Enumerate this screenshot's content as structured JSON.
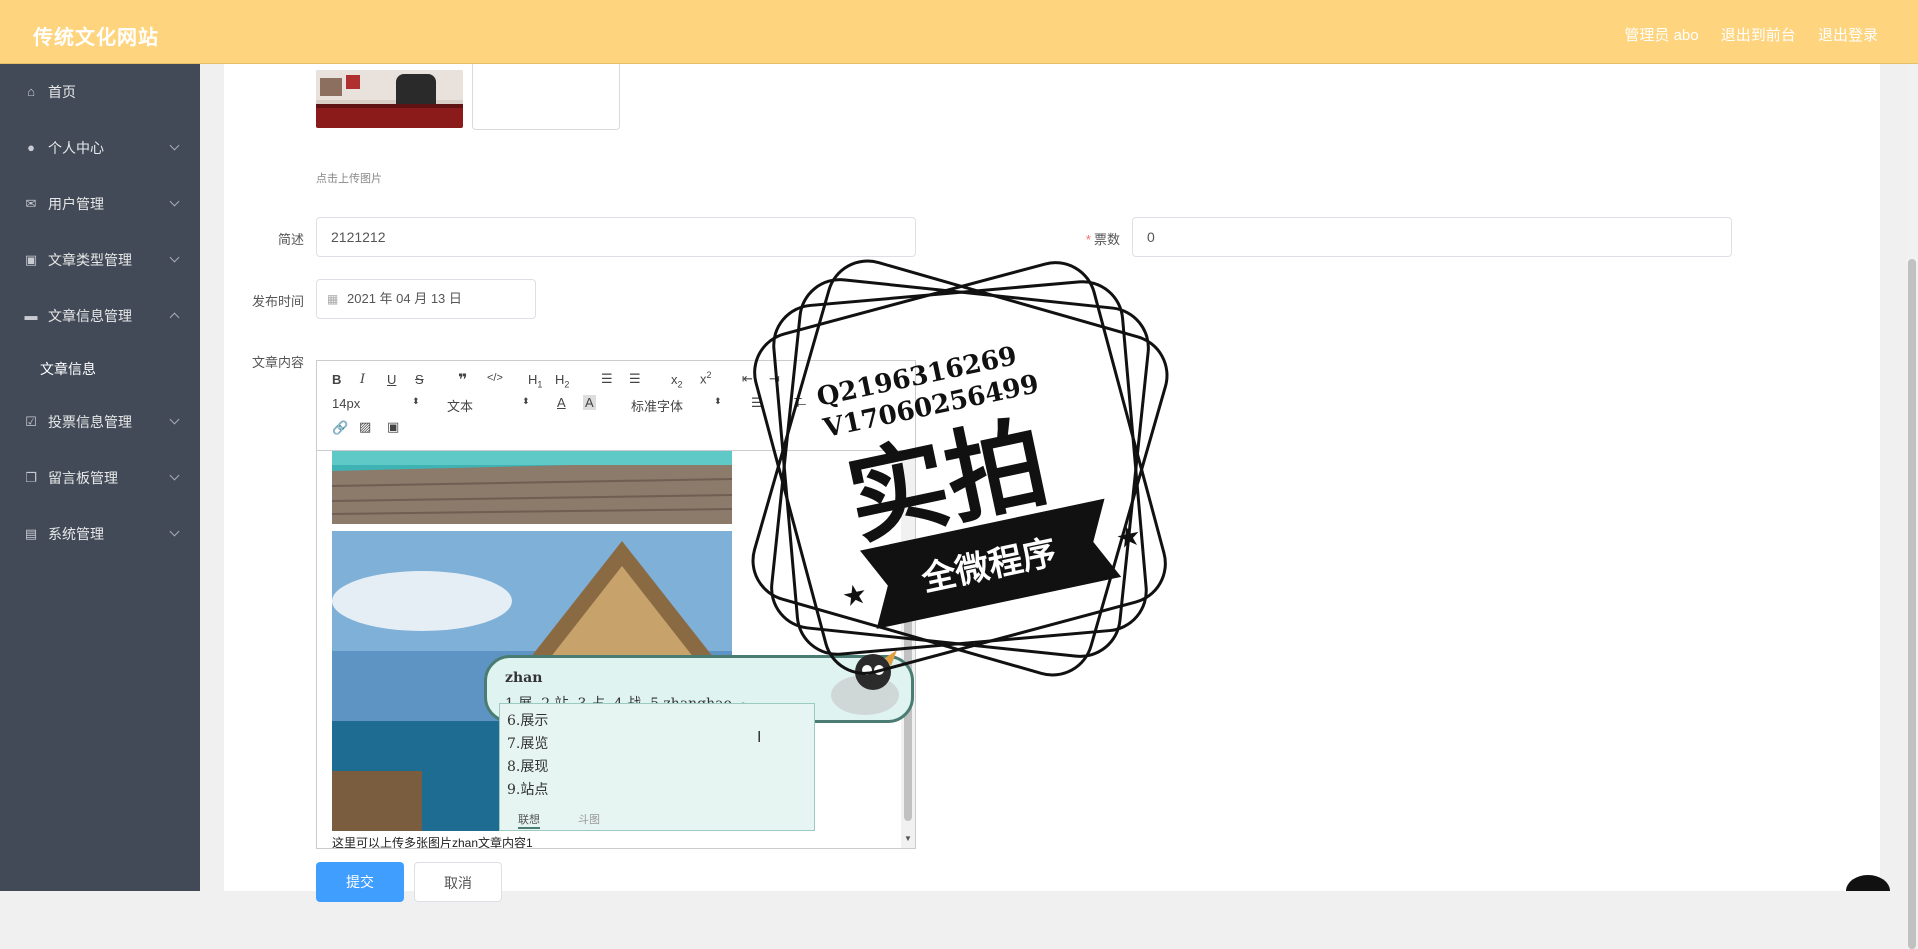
{
  "header": {
    "brand": "传统文化网站",
    "links": [
      "管理员 abo",
      "退出到前台",
      "退出登录"
    ]
  },
  "sidebar": {
    "items": [
      {
        "label": "首页",
        "icon": "home-icon",
        "expandable": false
      },
      {
        "label": "个人中心",
        "icon": "user-icon",
        "expandable": true
      },
      {
        "label": "用户管理",
        "icon": "mail-icon",
        "expandable": true
      },
      {
        "label": "文章类型管理",
        "icon": "clipboard-icon",
        "expandable": true
      },
      {
        "label": "文章信息管理",
        "icon": "briefcase-icon",
        "expandable": true,
        "expanded": true
      },
      {
        "label": "文章信息",
        "sub": true
      },
      {
        "label": "投票信息管理",
        "icon": "check-icon",
        "expandable": true
      },
      {
        "label": "留言板管理",
        "icon": "copy-icon",
        "expandable": true
      },
      {
        "label": "系统管理",
        "icon": "id-card-icon",
        "expandable": true
      }
    ]
  },
  "form": {
    "upload_hint": "点击上传图片",
    "desc_label": "简述",
    "desc_value": "2121212",
    "votes_label": "票数",
    "votes_value": "0",
    "date_label": "发布时间",
    "date_value": "2021 年 04 月 13 日",
    "content_label": "文章内容",
    "submit": "提交",
    "cancel": "取消"
  },
  "editor": {
    "font_size": "14px",
    "block_type": "文本",
    "font_family": "标准字体",
    "text_line": "这里可以上传多张图片zhan文章内容1"
  },
  "ime": {
    "input": "zhan",
    "candidates_row": [
      "1.展",
      "2.站",
      "3.占",
      "4.战",
      "5.zhanghao"
    ],
    "candidates_list": [
      "6.展示",
      "7.展览",
      "8.展现",
      "9.站点"
    ],
    "tabs": [
      "联想",
      "斗图"
    ]
  },
  "watermark": {
    "line1": "Q2196316269",
    "line2": "V17060256499",
    "big": "实拍",
    "ribbon": "全微程序"
  },
  "colors": {
    "topbar": "#fed47e",
    "sidebar": "#424a58",
    "primary": "#409eff"
  }
}
